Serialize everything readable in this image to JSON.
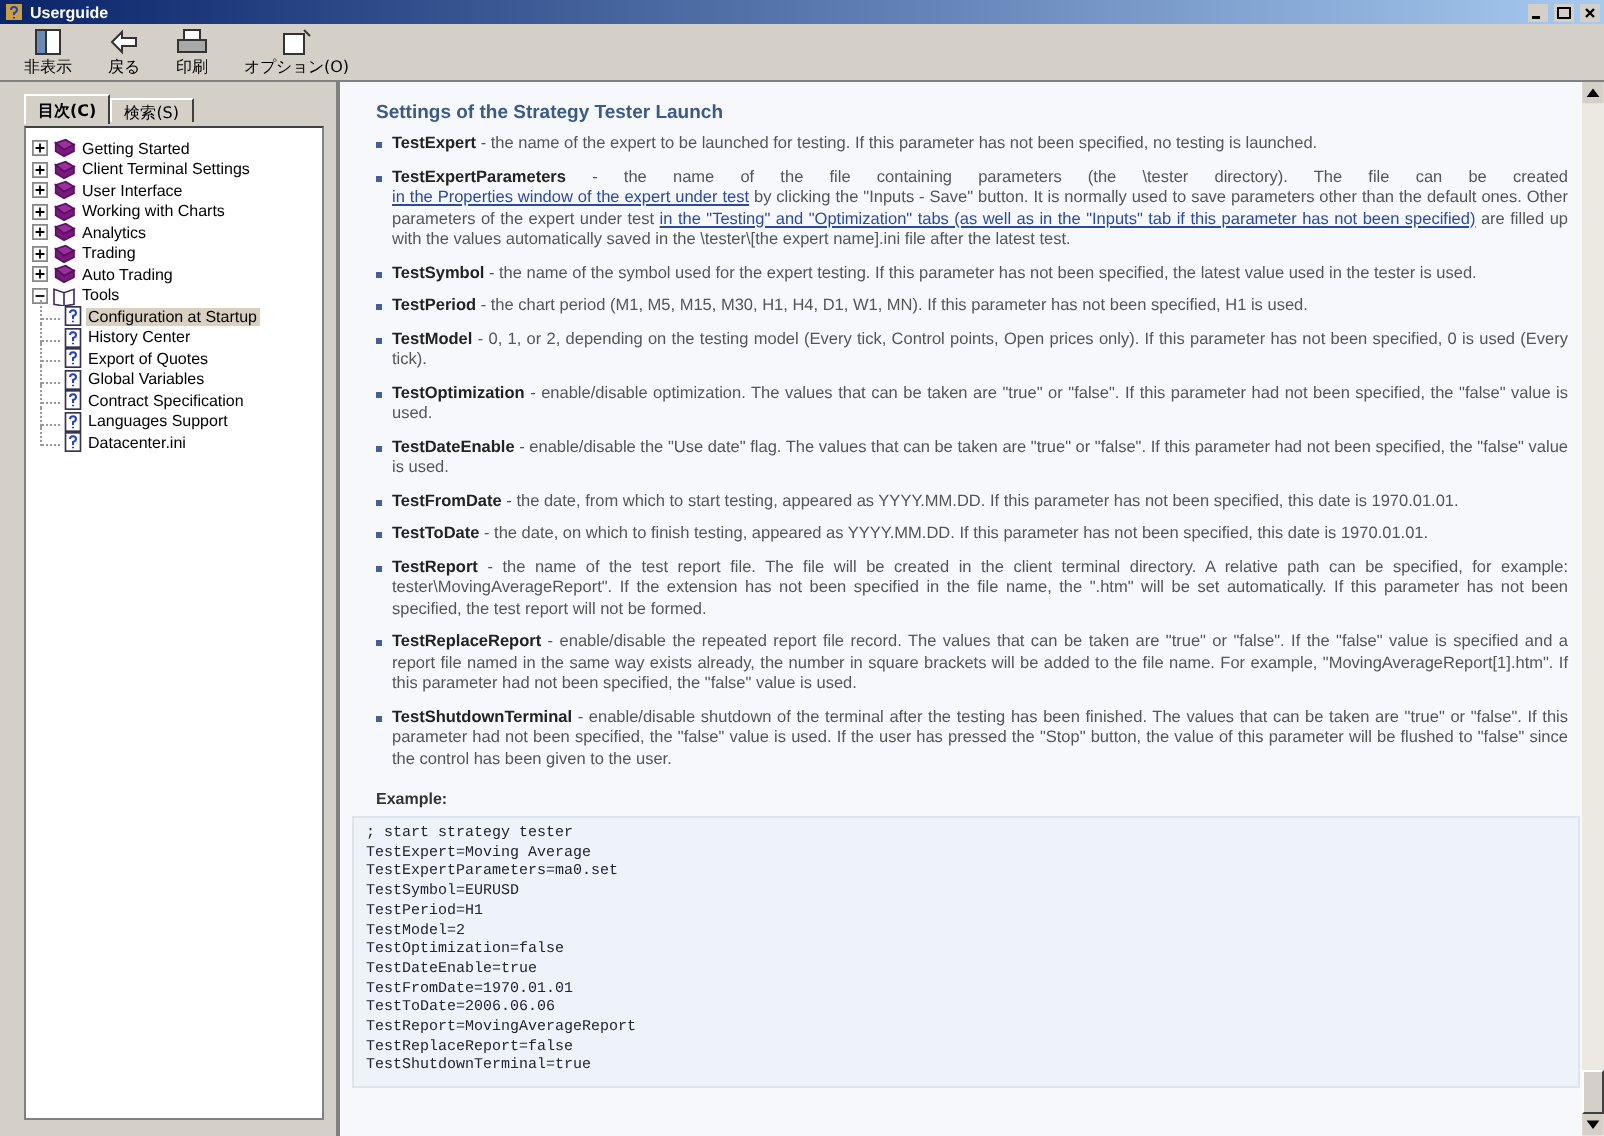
{
  "window": {
    "title": "Userguide"
  },
  "toolbar": [
    {
      "kind": "hide",
      "label": "非表示"
    },
    {
      "kind": "back",
      "label": "戻る"
    },
    {
      "kind": "print",
      "label": "印刷"
    },
    {
      "kind": "options",
      "label": "オプション(O)"
    }
  ],
  "tabs": [
    {
      "label": "目次(C)",
      "selected": true
    },
    {
      "label": "検索(S)",
      "selected": false
    }
  ],
  "tree": [
    {
      "label": "Getting Started",
      "expanded": false,
      "selected": false
    },
    {
      "label": "Client Terminal Settings",
      "expanded": false,
      "selected": false
    },
    {
      "label": "User Interface",
      "expanded": false,
      "selected": false
    },
    {
      "label": "Working with Charts",
      "expanded": false,
      "selected": false
    },
    {
      "label": "Analytics",
      "expanded": false,
      "selected": false
    },
    {
      "label": "Trading",
      "expanded": false,
      "selected": false
    },
    {
      "label": "Auto Trading",
      "expanded": false,
      "selected": false
    },
    {
      "label": "Tools",
      "expanded": true,
      "selected": false,
      "children": [
        {
          "label": "Configuration at Startup",
          "selected": true
        },
        {
          "label": "History Center",
          "selected": false
        },
        {
          "label": "Export of Quotes",
          "selected": false
        },
        {
          "label": "Global Variables",
          "selected": false
        },
        {
          "label": "Contract Specification",
          "selected": false
        },
        {
          "label": "Languages Support",
          "selected": false
        },
        {
          "label": "Datacenter.ini",
          "selected": false
        }
      ]
    }
  ],
  "content": {
    "heading": "Settings of the Strategy Tester Launch",
    "items": [
      {
        "name": "TestExpert",
        "segments": [
          {
            "kind": "text",
            "text": " - the name of the expert to be launched for testing. If this parameter has not been specified, no testing is launched."
          }
        ]
      },
      {
        "name": "TestExpertParameters",
        "segments": [
          {
            "kind": "text",
            "text": " - the name of the file containing parameters (the \\tester directory). The file can be created "
          },
          {
            "kind": "link",
            "text": "in the Properties window of the expert under test"
          },
          {
            "kind": "text",
            "text": " by clicking the \"Inputs - Save\" button. It is normally used to save parameters other than the default ones. Other parameters of the expert under test "
          },
          {
            "kind": "link",
            "text": "in the \"Testing\" and \"Optimization\" tabs (as well as in the \"Inputs\" tab if this parameter has not been specified)"
          },
          {
            "kind": "text",
            "text": " are filled up with the values automatically saved in the \\tester\\[the expert name].ini file after the latest test."
          }
        ]
      },
      {
        "name": "TestSymbol",
        "segments": [
          {
            "kind": "text",
            "text": " - the name of the symbol used for the expert testing. If this parameter has not been specified, the latest value used in the tester is used."
          }
        ]
      },
      {
        "name": "TestPeriod",
        "segments": [
          {
            "kind": "text",
            "text": " - the chart period (M1, M5, M15, M30, H1, H4, D1, W1, MN). If this parameter has not been specified, H1 is used."
          }
        ]
      },
      {
        "name": "TestModel",
        "segments": [
          {
            "kind": "text",
            "text": " - 0, 1, or 2, depending on the testing model (Every tick, Control points, Open prices only). If this parameter has not been specified, 0 is used (Every tick)."
          }
        ]
      },
      {
        "name": "TestOptimization",
        "segments": [
          {
            "kind": "text",
            "text": " - enable/disable optimization. The values that can be taken are \"true\" or \"false\". If this parameter had not been specified, the \"false\" value is used."
          }
        ]
      },
      {
        "name": "TestDateEnable",
        "segments": [
          {
            "kind": "text",
            "text": " - enable/disable the \"Use date\" flag. The values that can be taken are \"true\" or \"false\". If this parameter had not been specified, the \"false\" value is used."
          }
        ]
      },
      {
        "name": "TestFromDate",
        "segments": [
          {
            "kind": "text",
            "text": " - the date, from which to start testing, appeared as YYYY.MM.DD. If this parameter has not been specified, this date is 1970.01.01."
          }
        ]
      },
      {
        "name": "TestToDate",
        "segments": [
          {
            "kind": "text",
            "text": " - the date, on which to finish testing, appeared as YYYY.MM.DD. If this parameter has not been specified, this date is 1970.01.01."
          }
        ]
      },
      {
        "name": "TestReport",
        "segments": [
          {
            "kind": "text",
            "text": " - the name of the test report file. The file will be created in the client terminal directory. A relative path can be specified, for example: tester\\MovingAverageReport\". If the extension has not been specified in the file name, the \".htm\" will be set automatically. If this parameter has not been specified, the test report will not be formed."
          }
        ]
      },
      {
        "name": "TestReplaceReport",
        "segments": [
          {
            "kind": "text",
            "text": " - enable/disable the repeated report file record. The values that can be taken are \"true\" or \"false\". If the \"false\" value is specified and a report file named in the same way exists already, the number in square brackets will be added to the file name. For example, \"MovingAverageReport[1].htm\". If this parameter had not been specified, the \"false\" value is used."
          }
        ]
      },
      {
        "name": "TestShutdownTerminal",
        "segments": [
          {
            "kind": "text",
            "text": " - enable/disable shutdown of the terminal after the testing has been finished. The values that can be taken are \"true\" or \"false\". If this parameter had not been specified, the \"false\" value is used. If the user has pressed the \"Stop\" button, the value of this parameter will be flushed to \"false\" since the control has been given to the user."
          }
        ]
      }
    ],
    "example_label": "Example:",
    "code_lines": [
      "; start strategy tester",
      "TestExpert=Moving Average",
      "TestExpertParameters=ma0.set",
      "TestSymbol=EURUSD",
      "TestPeriod=H1",
      "TestModel=2",
      "TestOptimization=false",
      "TestDateEnable=true",
      "TestFromDate=1970.01.01",
      "TestToDate=2006.06.06",
      "TestReport=MovingAverageReport",
      "TestReplaceReport=false",
      "TestShutdownTerminal=true"
    ]
  }
}
